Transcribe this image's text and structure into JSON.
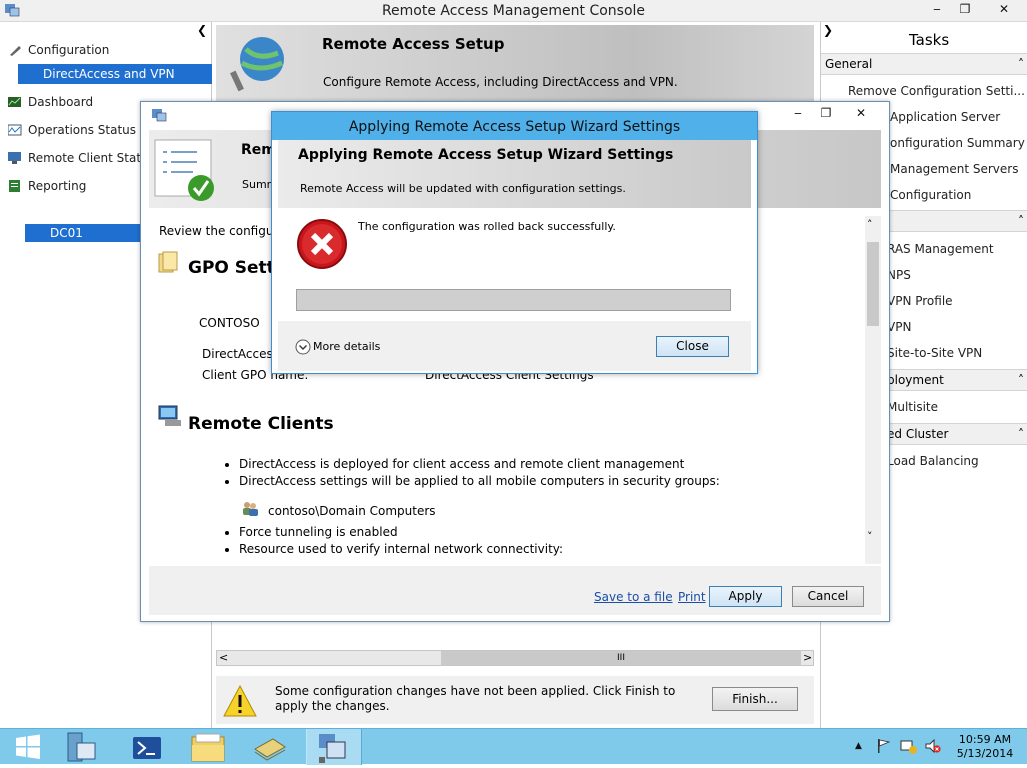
{
  "window": {
    "title": "Remote Access Management Console",
    "minimize": "‒",
    "restore": "❐",
    "close": "✕",
    "collapse": "❮"
  },
  "sidebar": {
    "items": [
      {
        "label": "Configuration"
      },
      {
        "label": "DirectAccess and VPN"
      },
      {
        "label": "Dashboard"
      },
      {
        "label": "Operations Status"
      },
      {
        "label": "Remote Client Status"
      },
      {
        "label": "Reporting"
      }
    ],
    "server": "DC01"
  },
  "banner": {
    "title": "Remote Access Setup",
    "subtitle": "Configure Remote Access, including DirectAccess and VPN."
  },
  "tasks": {
    "title": "Tasks",
    "expand": "❯",
    "sections": [
      {
        "title": "General",
        "items": [
          "Remove Configuration Setti...",
          "Application Server",
          "onfiguration Summary",
          "Management Servers",
          "Configuration"
        ]
      },
      {
        "title": "",
        "items": [
          "RAS Management",
          "NPS",
          "VPN Profile",
          "VPN",
          "Site-to-Site VPN"
        ]
      },
      {
        "title": "ployment",
        "items": [
          "Multisite"
        ]
      },
      {
        "title": "ed Cluster",
        "items": [
          "Load Balancing"
        ]
      }
    ]
  },
  "wizard": {
    "title_icon": "server-icon",
    "header_title": "Rem",
    "header_sub": "Summ",
    "review_text": "Review the configur",
    "gpo_heading": "GPO Setti",
    "domain": "CONTOSO",
    "da_label": "DirectAccess",
    "client_gpo_label": "Client GPO name:",
    "client_gpo_value": "DirectAccess Client Settings",
    "clients_heading": "Remote Clients",
    "bullets": [
      "DirectAccess is deployed for client access and remote client management",
      "DirectAccess settings will be applied to all mobile computers in security groups:"
    ],
    "group": "contoso\\Domain Computers",
    "bullets2": [
      "Force tunneling is enabled",
      "Resource used to verify internal network connectivity:"
    ],
    "save_link": "Save to a file",
    "print_link": "Print",
    "apply": "Apply",
    "cancel": "Cancel"
  },
  "dialog": {
    "title": "Applying Remote Access Setup Wizard Settings",
    "header": "Applying Remote Access Setup Wizard Settings",
    "subheader": "Remote Access will be updated with configuration settings.",
    "message": "The configuration was rolled back successfully.",
    "progress": 0,
    "more_details": "More details",
    "close": "Close"
  },
  "hscroll": {
    "grip": "III",
    "left": "<",
    ".right": ">",
    "right": ">"
  },
  "notice": {
    "text": "Some configuration changes have not been applied. Click Finish to apply the changes.",
    "finish": "Finish..."
  },
  "clock": {
    "time": "10:59 AM",
    "date": "5/13/2014"
  },
  "colors": {
    "accent": "#1f6fd0",
    "taskbar": "#7fc9ea",
    "dialog_title": "#4fb0ea",
    "error": "#c8161b"
  }
}
